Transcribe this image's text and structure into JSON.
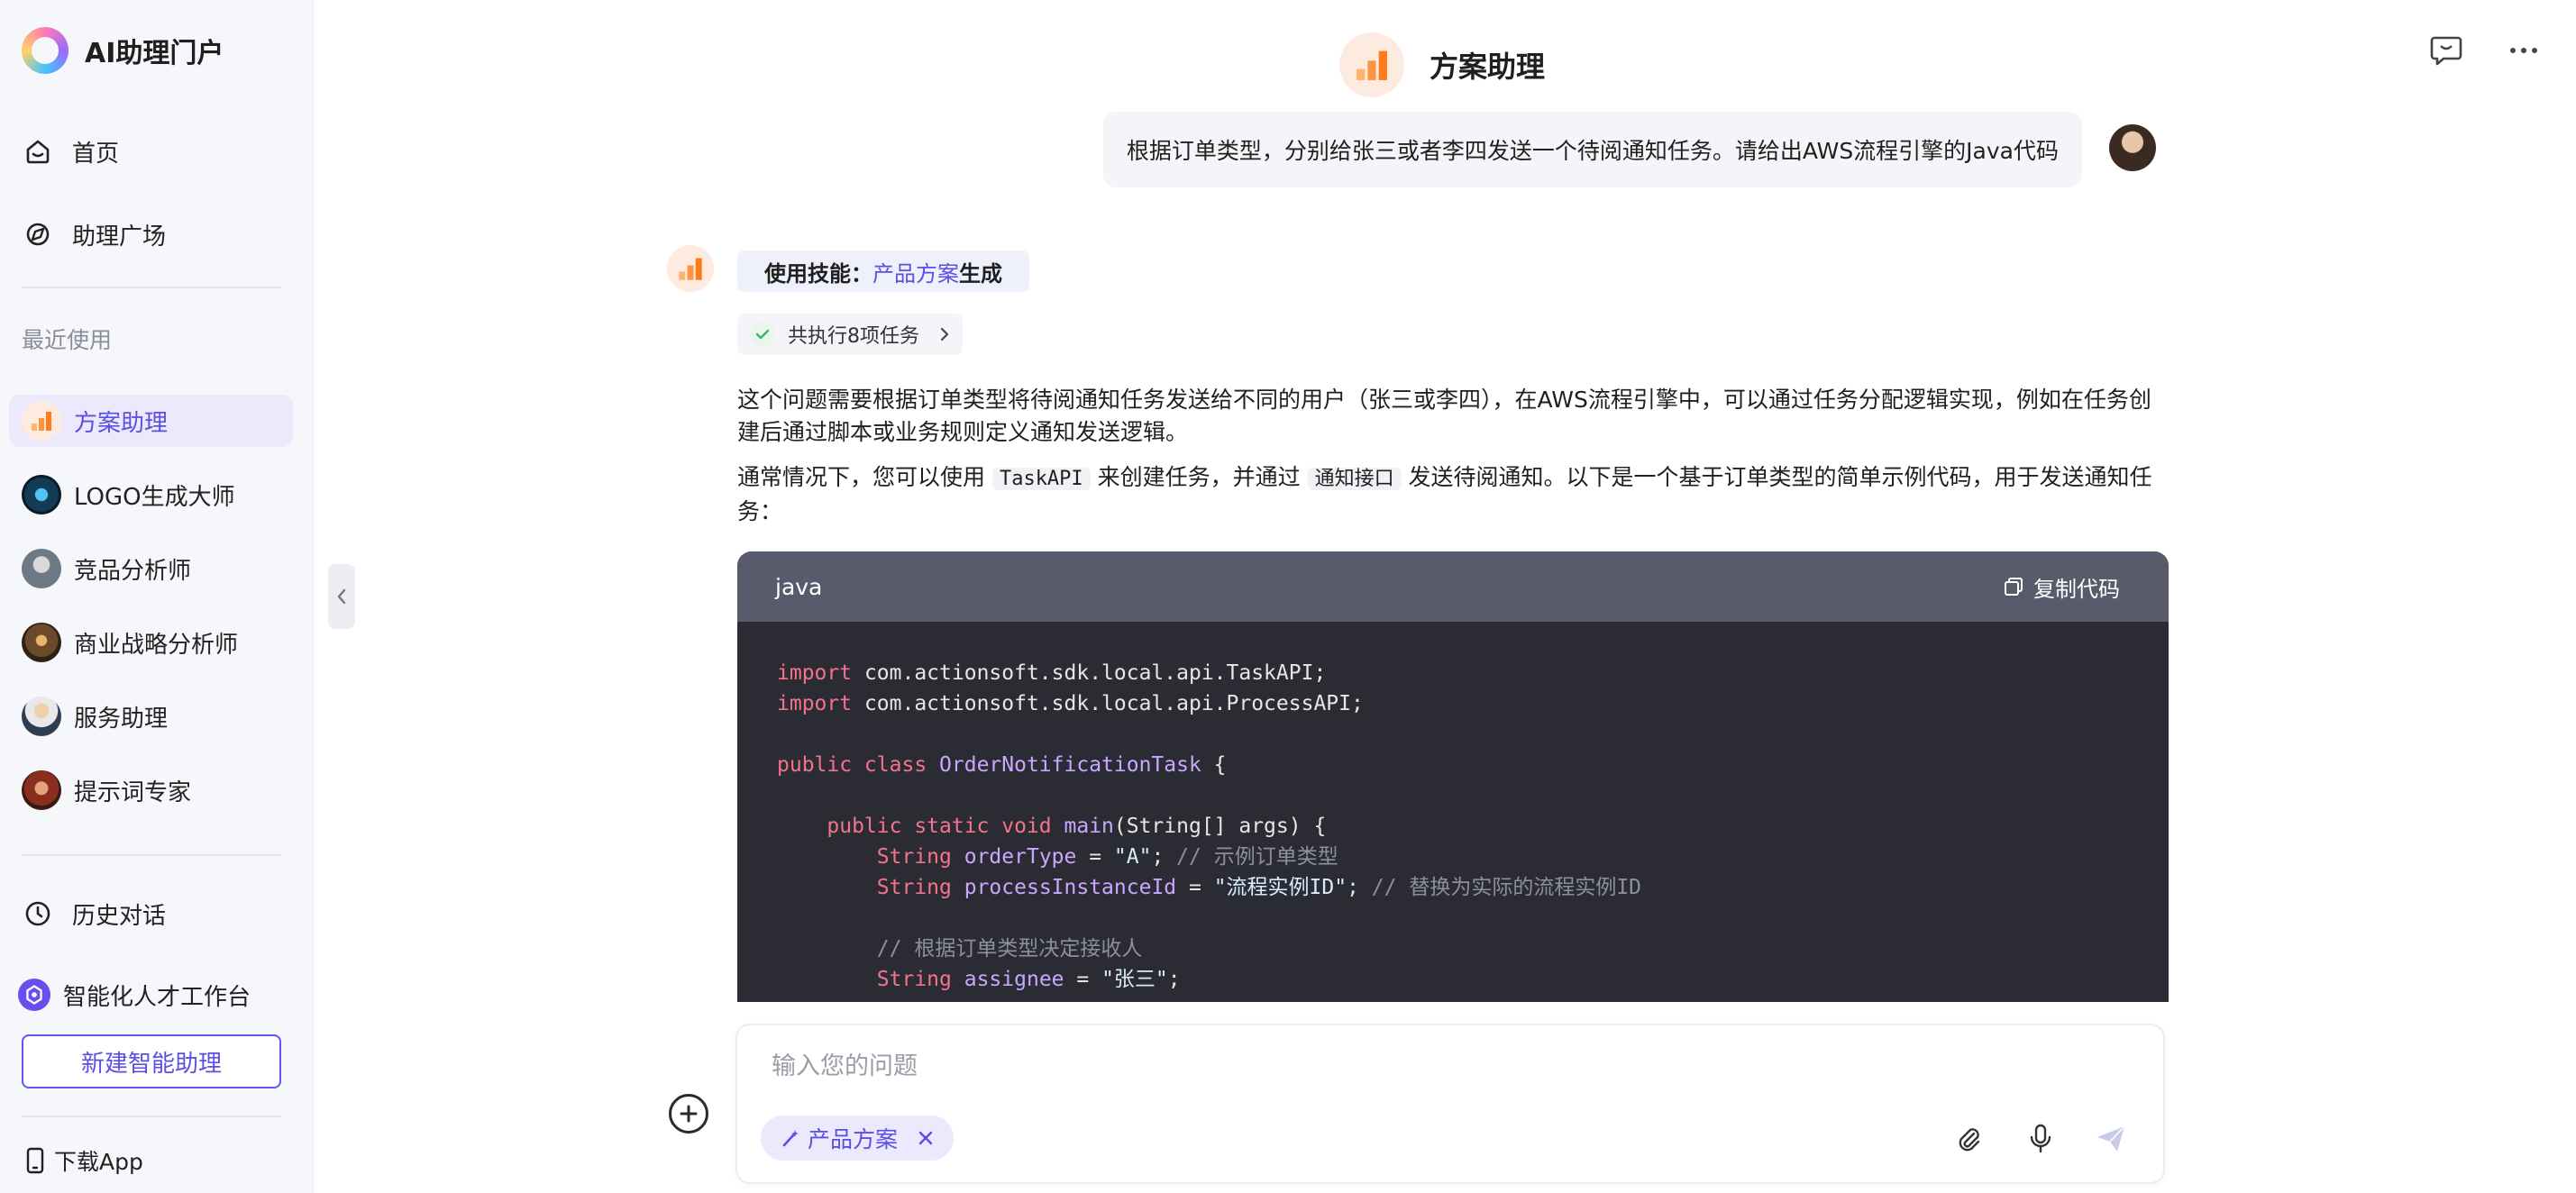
{
  "brand": {
    "name": "AI助理门户"
  },
  "nav": {
    "home": "首页",
    "plaza": "助理广场"
  },
  "recent": {
    "title": "最近使用",
    "items": [
      {
        "label": "方案助理",
        "active": true
      },
      {
        "label": "LOGO生成大师"
      },
      {
        "label": "竞品分析师"
      },
      {
        "label": "商业战略分析师"
      },
      {
        "label": "服务助理"
      },
      {
        "label": "提示词专家"
      }
    ]
  },
  "bottom_nav": {
    "history": "历史对话",
    "workbench": "智能化人才工作台",
    "new_assistant": "新建智能助理",
    "download": "下载App"
  },
  "header": {
    "title": "方案助理"
  },
  "chat": {
    "user_message": "根据订单类型，分别给张三或者李四发送一个待阅通知任务。请给出AWS流程引擎的Java代码",
    "skill_prefix": "使用技能：",
    "skill_name": "产品方案",
    "skill_suffix": "生成",
    "tasks_label": "共执行8项任务",
    "para1": "这个问题需要根据订单类型将待阅通知任务发送给不同的用户（张三或李四），在AWS流程引擎中，可以通过任务分配逻辑实现，例如在任务创建后通过脚本或业务规则定义通知发送逻辑。",
    "para2_a": "通常情况下，您可以使用 ",
    "para2_code1": "TaskAPI",
    "para2_b": " 来创建任务，并通过 ",
    "para2_code2": "通知接口",
    "para2_c": " 发送待阅通知。以下是一个基于订单类型的简单示例代码，用于发送通知任务：",
    "code_lang": "java",
    "copy_label": "复制代码"
  },
  "code": {
    "l1_kw": "import",
    "l1_rest": " com.actionsoft.sdk.local.api.TaskAPI;",
    "l2_kw": "import",
    "l2_rest": " com.actionsoft.sdk.local.api.ProcessAPI;",
    "l4_kw": "public class",
    "l4_cls": "OrderNotificationTask",
    "l4_rest": " {",
    "l6_kw": "public static void",
    "l6_fn": "main",
    "l6_rest": "(String[] args) {",
    "l7_ty": "String",
    "l7_var": "orderType",
    "l7_eq": " = ",
    "l7_str": "\"A\"",
    "l7_semi": "; ",
    "l7_cm": "// 示例订单类型",
    "l8_ty": "String",
    "l8_var": "processInstanceId",
    "l8_eq": " = ",
    "l8_str": "\"流程实例ID\"",
    "l8_semi": "; ",
    "l8_cm": "// 替换为实际的流程实例ID",
    "l10_cm": "// 根据订单类型决定接收人",
    "l11_ty": "String",
    "l11_var": "assignee",
    "l11_eq": " = ",
    "l11_str": "\"张三\"",
    "l11_semi": ";"
  },
  "composer": {
    "placeholder": "输入您的问题",
    "chip": "产品方案"
  },
  "colors": {
    "accent": "#5b4ee3",
    "code_bg": "#2b2c33",
    "code_head": "#585b6b"
  },
  "icons": [
    "home-icon",
    "plaza-icon",
    "history-icon",
    "workbench-icon",
    "phone-icon",
    "feedback-icon",
    "more-icon",
    "copy-icon",
    "attach-icon",
    "mic-icon",
    "send-icon",
    "plus-icon",
    "check-icon",
    "chevron-right-icon",
    "chevron-left-icon",
    "wand-icon",
    "close-icon"
  ]
}
